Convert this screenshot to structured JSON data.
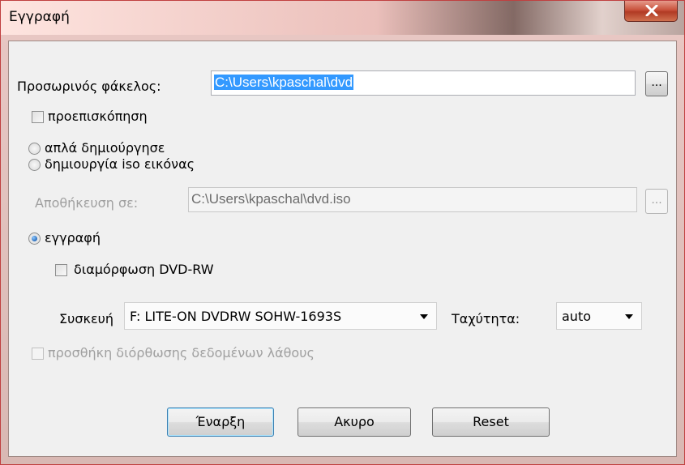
{
  "window": {
    "title": "Εγγραφή"
  },
  "temp_folder": {
    "label": "Προσωρινός φάκελος:",
    "value": "C:\\Users\\kpaschal\\dvd",
    "browse_label": "..."
  },
  "preview": {
    "label": "προεπισκόπηση",
    "checked": false
  },
  "mode_options": [
    {
      "label": "απλά δημιούργησε",
      "selected": false
    },
    {
      "label": "δημιουργία iso εικόνας",
      "selected": false
    },
    {
      "label": "εγγραφή",
      "selected": true
    }
  ],
  "save_to": {
    "label": "Αποθήκευση σε:",
    "value": "C:\\Users\\kpaschal\\dvd.iso",
    "browse_label": "..."
  },
  "format_dvdrw": {
    "label": "διαμόρφωση DVD-RW",
    "checked": false
  },
  "device": {
    "label": "Συσκευή",
    "selected": "F: LITE-ON DVDRW SOHW-1693S"
  },
  "speed": {
    "label": "Ταχύτητα:",
    "selected": "auto"
  },
  "error_correction": {
    "label": "προσθήκη διόρθωσης δεδομένων λάθους",
    "checked": false
  },
  "buttons": {
    "start": "Έναρξη",
    "cancel": "Ακυρο",
    "reset": "Reset"
  }
}
